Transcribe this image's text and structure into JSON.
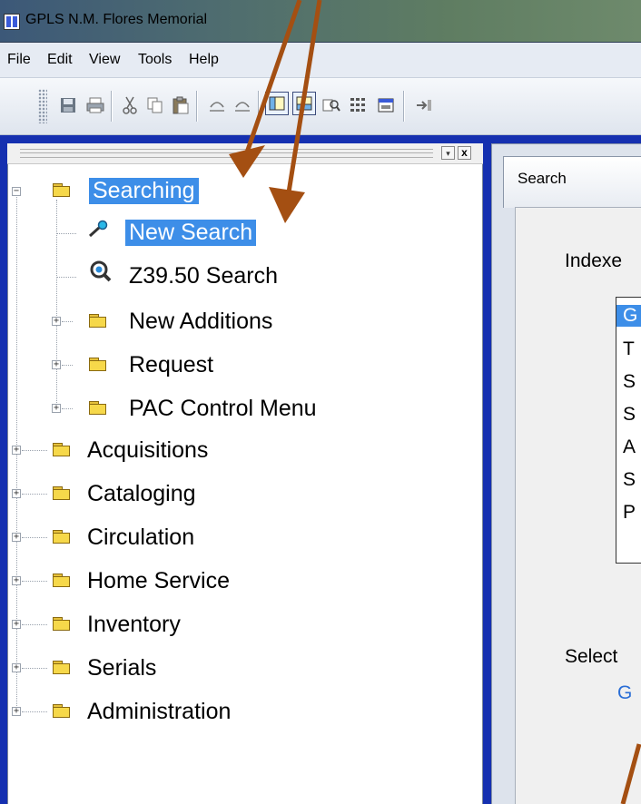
{
  "window": {
    "title": "GPLS N.M. Flores Memorial"
  },
  "menu": {
    "file": "File",
    "edit": "Edit",
    "view": "View",
    "tools": "Tools",
    "help": "Help"
  },
  "toolbar": {
    "icons": [
      "save-icon",
      "print-icon",
      "cut-icon",
      "copy-icon",
      "paste-icon",
      "undo-icon",
      "redo-icon",
      "layout-left-icon",
      "layout-bottom-icon",
      "search-records-icon",
      "grid-icon",
      "window-icon",
      "import-icon"
    ]
  },
  "tree_pane": {
    "close_label": "x",
    "dropdown_label": "▾"
  },
  "tree": {
    "searching": "Searching",
    "new_search": "New Search",
    "z3950": "Z39.50 Search",
    "new_additions": "New Additions",
    "request": "Request",
    "pac_control": "PAC Control Menu",
    "acquisitions": "Acquisitions",
    "cataloging": "Cataloging",
    "circulation": "Circulation",
    "home_service": "Home Service",
    "inventory": "Inventory",
    "serials": "Serials",
    "administration": "Administration",
    "expand_plus": "+",
    "collapse_minus": "−"
  },
  "search_panel": {
    "tab_label": "Search",
    "indexes_label": "Indexe",
    "index_items": [
      "G",
      "T",
      "S",
      "S",
      "A",
      "S",
      "P"
    ],
    "select_label": "Select",
    "go_link": "G"
  },
  "colors": {
    "selection": "#3d8ee8",
    "arrow": "#a44f12",
    "desktop": "#1530b0"
  }
}
